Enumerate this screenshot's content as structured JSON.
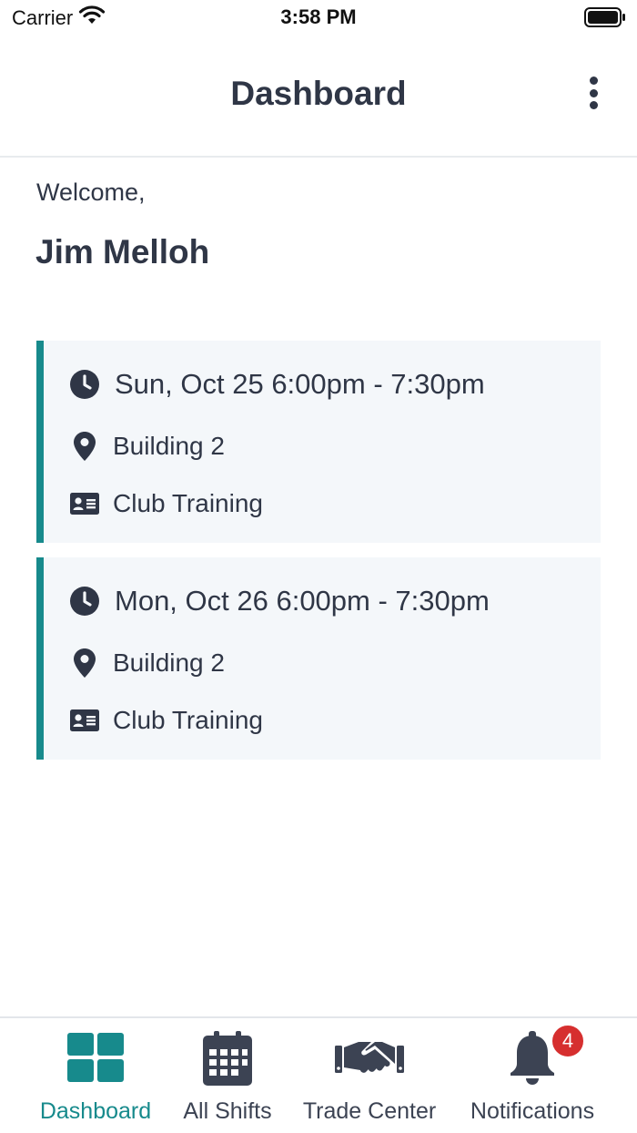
{
  "status_bar": {
    "carrier": "Carrier",
    "time": "3:58 PM",
    "wifi_icon": "wifi-icon",
    "battery_icon": "battery-icon"
  },
  "header": {
    "title": "Dashboard",
    "menu_icon": "more-vertical-icon"
  },
  "greeting": {
    "welcome": "Welcome,",
    "name": "Jim Melloh"
  },
  "shifts": [
    {
      "datetime": "Sun, Oct 25 6:00pm - 7:30pm",
      "location": "Building 2",
      "role": "Club Training"
    },
    {
      "datetime": "Mon, Oct 26 6:00pm - 7:30pm",
      "location": "Building 2",
      "role": "Club Training"
    }
  ],
  "tabbar": {
    "tabs": [
      {
        "label": "Dashboard",
        "icon": "dashboard-grid-icon",
        "active": true
      },
      {
        "label": "All Shifts",
        "icon": "calendar-icon",
        "active": false
      },
      {
        "label": "Trade Center",
        "icon": "handshake-icon",
        "active": false
      },
      {
        "label": "Notifications",
        "icon": "bell-icon",
        "active": false,
        "badge": "4"
      }
    ]
  },
  "colors": {
    "accent": "#178a8c",
    "text": "#2f3646",
    "card_bg": "#f4f7fa",
    "badge": "#d62f2f"
  }
}
